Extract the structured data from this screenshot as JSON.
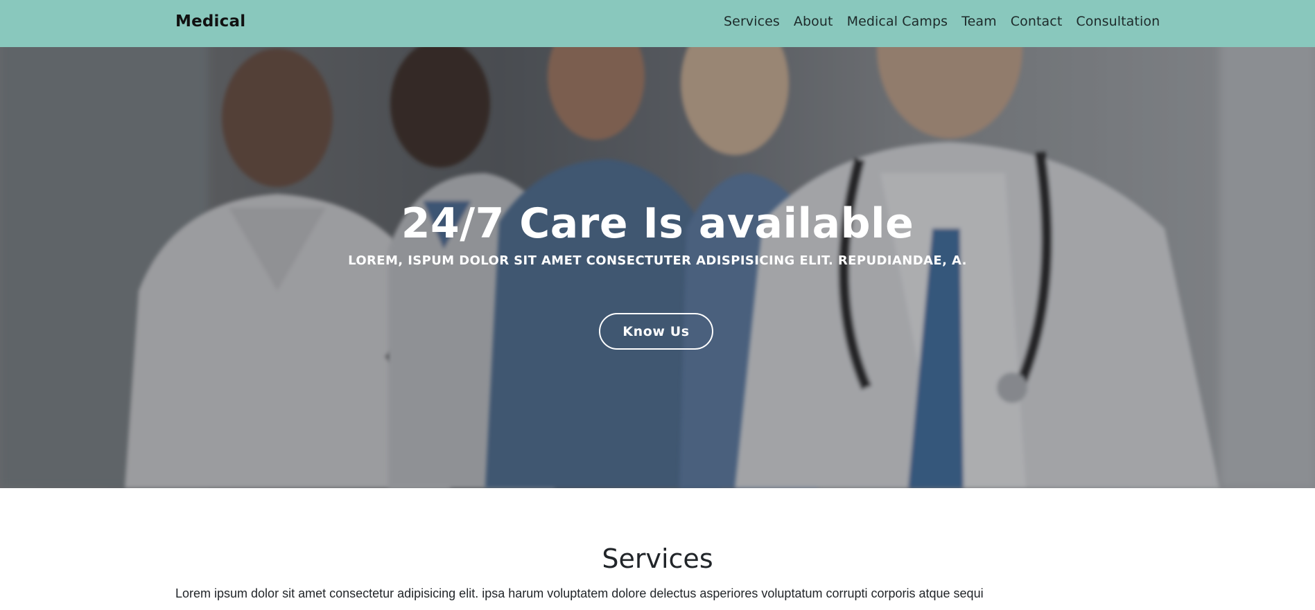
{
  "navbar": {
    "brand": "Medical",
    "links": [
      "Services",
      "About",
      "Medical Camps",
      "Team",
      "Contact",
      "Consultation"
    ]
  },
  "hero": {
    "title": "24/7 Care Is available",
    "subtitle": "LOREM, ISPUM DOLOR SIT AMET CONSECTUTER ADISPISICING ELIT. REPUDIANDAE, A.",
    "button_label": "Know Us"
  },
  "services": {
    "title": "Services",
    "text": "Lorem ipsum dolor sit amet consectetur adipisicing elit. ipsa harum voluptatem dolore delectus asperiores voluptatum corrupti corporis atque sequi"
  },
  "colors": {
    "navbar_bg": "#89c8bd",
    "hero_text": "#ffffff",
    "body_text": "#212529"
  }
}
